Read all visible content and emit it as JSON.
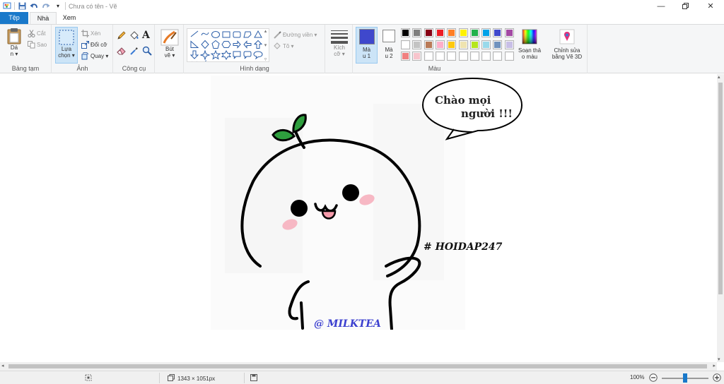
{
  "window": {
    "title": "Chưa có tên - Vẽ",
    "quick_access_icons": [
      "paint-app-icon",
      "save-icon",
      "undo-icon",
      "redo-icon",
      "customize-icon"
    ],
    "controls": [
      "minimize",
      "restore",
      "close"
    ]
  },
  "tabs": [
    {
      "label": "Tệp",
      "active": false
    },
    {
      "label": "Nhà",
      "active": true
    },
    {
      "label": "Xem",
      "active": false
    }
  ],
  "ribbon": {
    "clipboard": {
      "group_label": "Bảng tạm",
      "paste_label_1": "Dá",
      "paste_label_2": "n ▾",
      "cut": "Cắt",
      "copy": "Sao"
    },
    "image": {
      "group_label": "Ảnh",
      "select_label_1": "Lựa",
      "select_label_2": "chọn ▾",
      "crop": "Xén",
      "resize": "Đổi cỡ",
      "rotate": "Quay ▾"
    },
    "tools": {
      "group_label": "Công cụ",
      "items": [
        "pencil-icon",
        "fill-icon",
        "text-icon",
        "eraser-icon",
        "color-picker-icon",
        "magnifier-icon"
      ]
    },
    "brushes": {
      "label_1": "Bút",
      "label_2": "vẽ ▾"
    },
    "shapes": {
      "group_label": "Hình dạng",
      "outline": "Đường viền ▾",
      "fill": "Tô ▾"
    },
    "size": {
      "label_1": "Kích",
      "label_2": "cỡ ▾"
    },
    "colors": {
      "group_label": "Màu",
      "color1_label_1": "Mà",
      "color1_label_2": "u 1",
      "color2_label_1": "Mà",
      "color2_label_2": "u 2",
      "color1_value": "#3f48cc",
      "color2_value": "#ffffff",
      "edit_colors_1": "Soạn thả",
      "edit_colors_2": "o màu",
      "paint3d_1": "Chỉnh sửa",
      "paint3d_2": "bằng Vẽ 3D",
      "palette": [
        "#000000",
        "#7f7f7f",
        "#880015",
        "#ed1c24",
        "#ff7f27",
        "#fff200",
        "#22b14c",
        "#00a2e8",
        "#3f48cc",
        "#a349a4",
        "#ffffff",
        "#c3c3c3",
        "#b97a57",
        "#ffaec9",
        "#ffc90e",
        "#efe4b0",
        "#b5e61d",
        "#99d9ea",
        "#7092be",
        "#c8bfe7",
        "#f08080",
        "#f7c4cc",
        "#ffffff",
        "#ffffff",
        "#ffffff",
        "#ffffff",
        "#ffffff",
        "#ffffff",
        "#ffffff",
        "#ffffff"
      ]
    }
  },
  "drawing": {
    "bubble_line1": "Chào mọi",
    "bubble_line2": "người !!!",
    "tag_hoidap": "# HOIDAP247",
    "tag_milktea": "@ MILKTEA"
  },
  "status": {
    "dimensions": "1343 × 1051px",
    "zoom": "100%",
    "zoom_level": 0.5
  }
}
